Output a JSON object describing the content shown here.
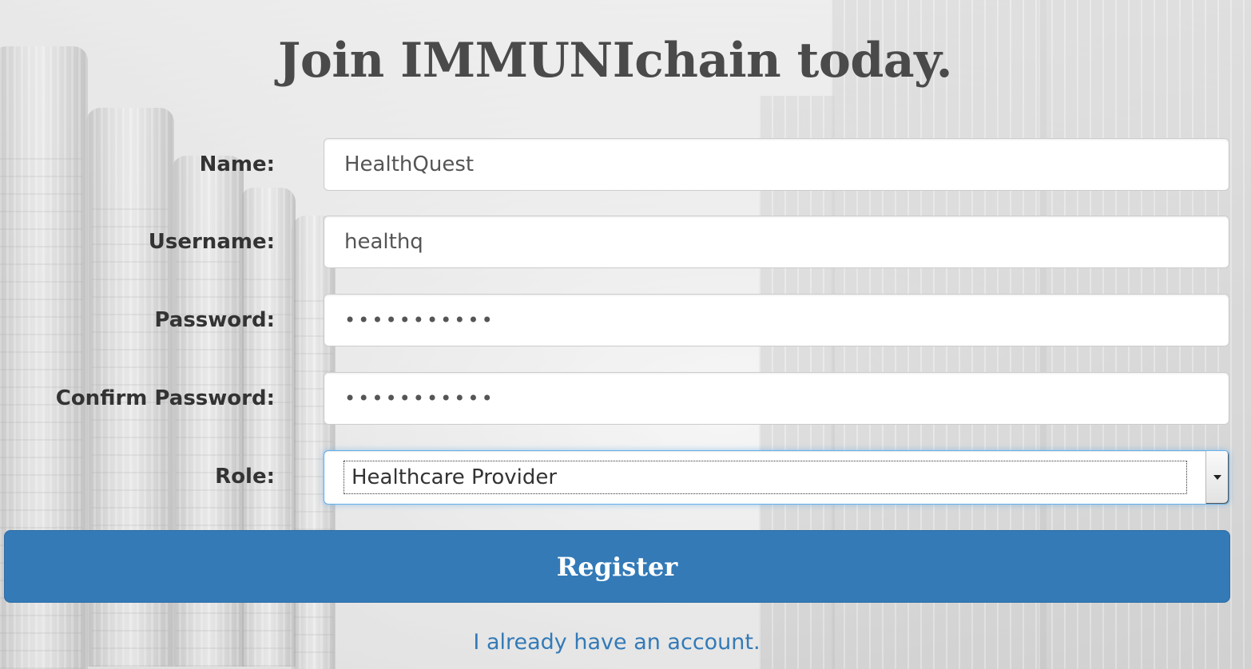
{
  "page": {
    "title": "Join IMMUNIchain today."
  },
  "form": {
    "name": {
      "label": "Name:",
      "value": "HealthQuest"
    },
    "username": {
      "label": "Username:",
      "value": "healthq"
    },
    "password": {
      "label": "Password:",
      "value": "•••••••••••"
    },
    "confirm_password": {
      "label": "Confirm Password:",
      "value": "•••••••••••"
    },
    "role": {
      "label": "Role:",
      "selected": "Healthcare Provider"
    },
    "submit_label": "Register"
  },
  "footer": {
    "login_link": "I already have an account."
  },
  "colors": {
    "primary": "#337ab7",
    "heading": "#4a4a4a",
    "label": "#333333",
    "focus_glow": "#66afe9"
  }
}
